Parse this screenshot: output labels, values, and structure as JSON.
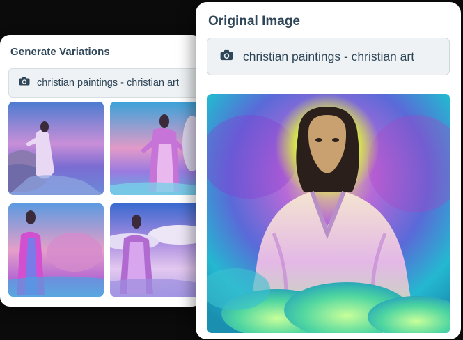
{
  "variations_card": {
    "title": "Generate Variations",
    "prompt": "christian paintings - christian art",
    "prompt_icon": "camera-icon",
    "thumbnails": [
      "variation-1",
      "variation-2",
      "variation-3",
      "variation-4"
    ]
  },
  "original_card": {
    "title": "Original Image",
    "prompt": "christian paintings - christian art",
    "prompt_icon": "camera-icon"
  },
  "colors": {
    "background": "#0b0b0c",
    "title_text": "#2f4658",
    "prompt_bg": "#eef2f4"
  }
}
